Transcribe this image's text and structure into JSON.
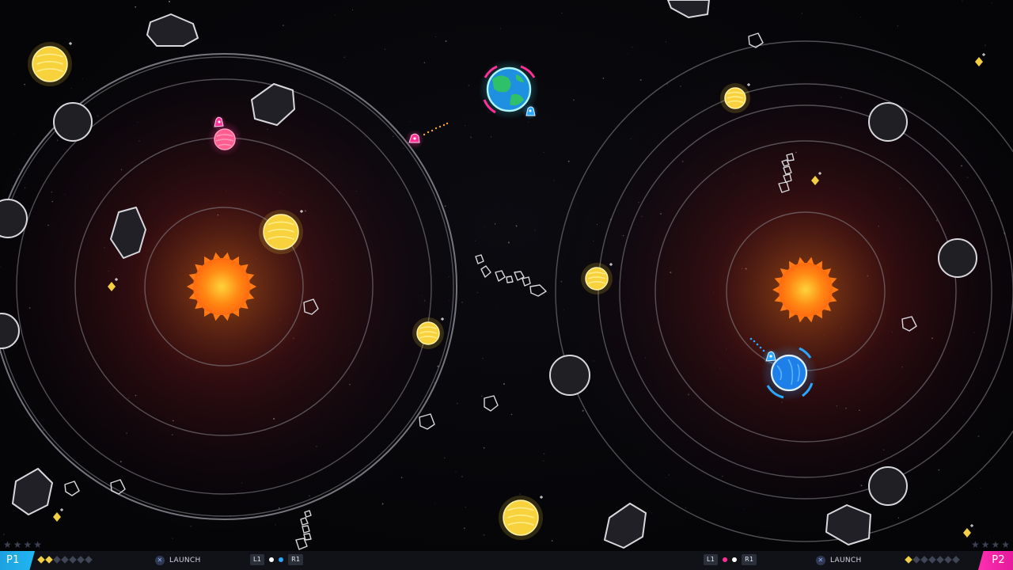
{
  "game": {
    "colors": {
      "sun": "#ff8c1a",
      "planet_yellow": "#f5cf3a",
      "p1_accent": "#ff2f96",
      "p2_accent": "#2aa8ff",
      "earth_cyan": "#3fe8ff",
      "orbit": "#8a8a92",
      "gem": "#f2cf44"
    },
    "icons": {
      "sun": "sun-icon",
      "planet": "planet-icon",
      "asteroid": "asteroid-icon",
      "ship": "rocket-icon",
      "gem": "gem-icon",
      "star": "star-icon"
    }
  },
  "hud": {
    "p1": {
      "tag": "P1",
      "gems_filled": 2,
      "gems_total": 7,
      "stars_filled": 0,
      "stars_total": 4,
      "launch_button": "✕",
      "launch_label": "LAUNCH",
      "left_shoulder": "L1",
      "right_shoulder": "R1"
    },
    "p2": {
      "tag": "P2",
      "gems_filled": 1,
      "gems_total": 7,
      "stars_filled": 0,
      "stars_total": 4,
      "launch_button": "✕",
      "launch_label": "LAUNCH",
      "left_shoulder": "L1",
      "right_shoulder": "R1"
    }
  }
}
